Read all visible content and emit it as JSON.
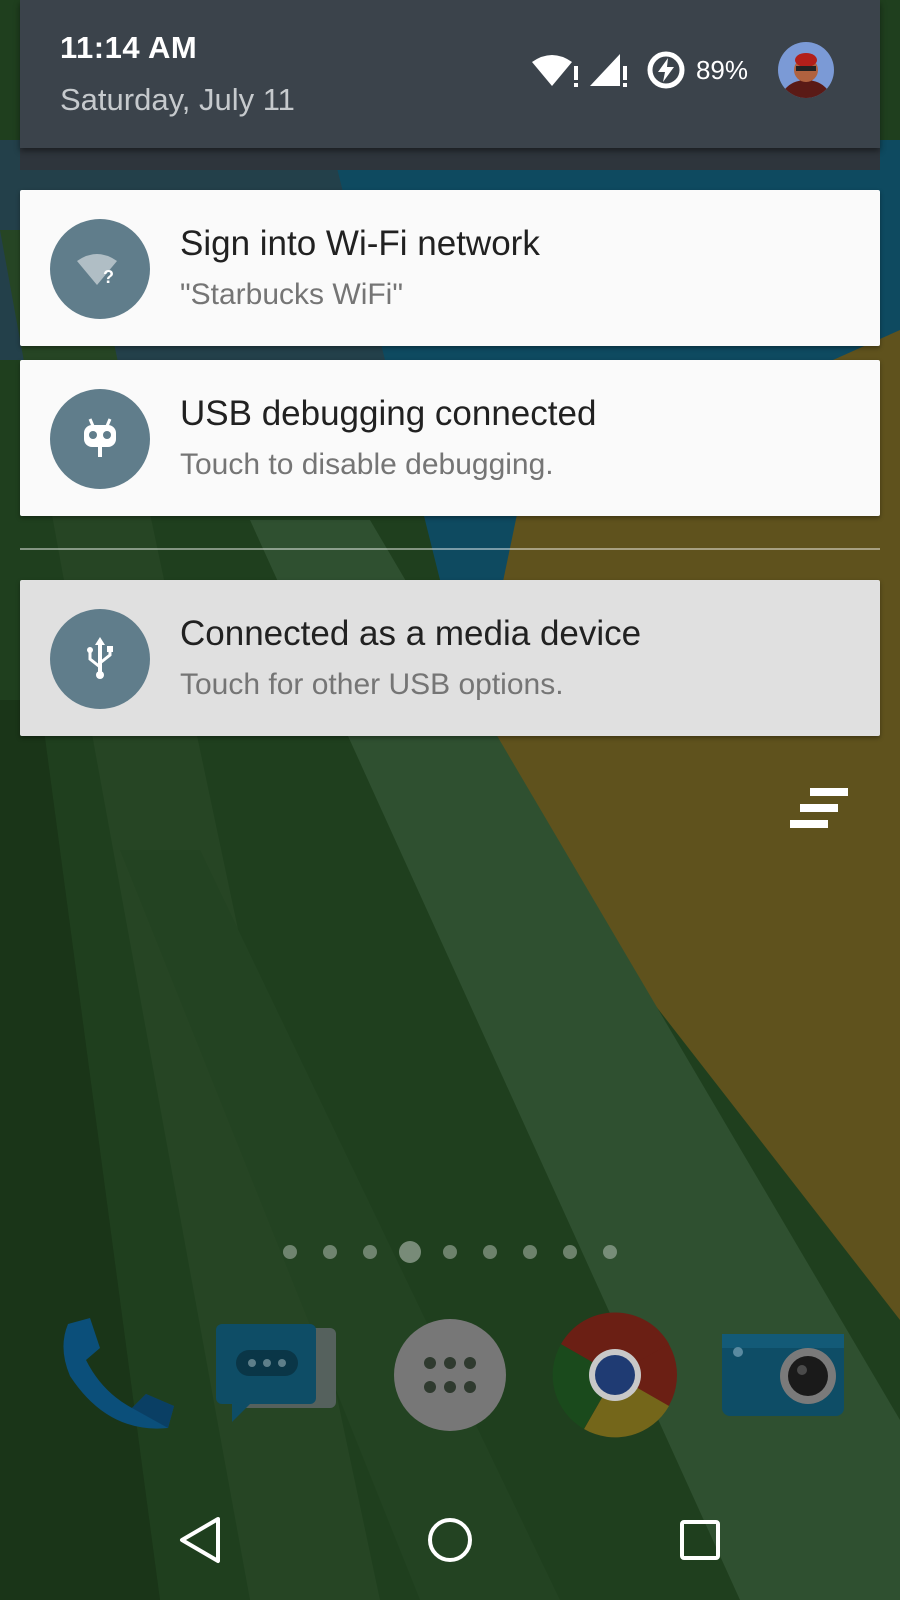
{
  "header": {
    "time": "11:14 AM",
    "date": "Saturday, July 11",
    "battery_percent": "89%"
  },
  "notifications": [
    {
      "title": "Sign into Wi-Fi network",
      "text": "\"Starbucks WiFi\"",
      "icon": "wifi-question-icon"
    },
    {
      "title": "USB debugging connected",
      "text": "Touch to disable debugging.",
      "icon": "android-debug-icon"
    },
    {
      "title": "Connected as a media device",
      "text": "Touch for other USB options.",
      "icon": "usb-icon"
    }
  ],
  "home": {
    "page_count": 9,
    "active_page": 4,
    "dock": [
      "phone-icon",
      "messaging-icon",
      "app-drawer-icon",
      "chrome-icon",
      "camera-icon"
    ]
  },
  "navbar": [
    "back-icon",
    "home-icon",
    "recents-icon"
  ],
  "colors": {
    "header_bg": "#3b434b",
    "notification_bg": "#fafafa",
    "notification_icon_bg": "#607d8b",
    "wallpaper_green": "#1f3f1e",
    "wallpaper_yellow": "#5f521d",
    "wallpaper_blue": "#0e4a60"
  }
}
